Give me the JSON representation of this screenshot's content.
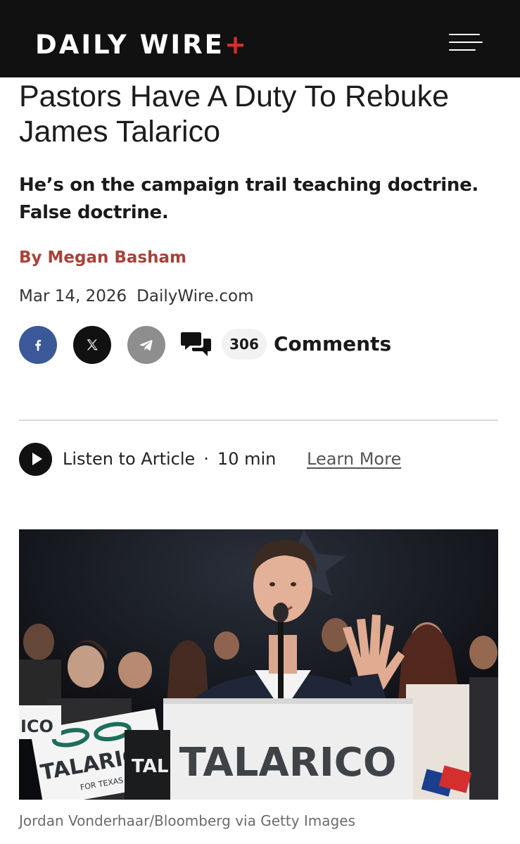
{
  "header": {
    "logo_text": "DAILY WIRE",
    "logo_plus": "+",
    "brand_color": "#d0312d",
    "menu_icon": "hamburger-menu-icon"
  },
  "article": {
    "title": "Pastors Have A Duty To Rebuke James Talarico",
    "subtitle": "He’s on the campaign trail teaching doctrine. False doctrine.",
    "byline_prefix": "By",
    "author": "Megan Basham",
    "date": "Mar 14, 2026",
    "source": "DailyWire.com",
    "author_color": "#a8423a"
  },
  "share": {
    "facebook_icon": "facebook-icon",
    "x_icon": "x-icon",
    "telegram_icon": "telegram-icon",
    "comments_icon": "comments-icon",
    "comment_count": "306",
    "comments_label": "Comments"
  },
  "audio": {
    "play_icon": "play-icon",
    "label": "Listen to Article",
    "separator": "·",
    "duration": "10 min",
    "learn_more": "Learn More"
  },
  "hero_image": {
    "podium_sign": "TALARICO",
    "sign_left": "TALARICO",
    "sign_left_sub": "FOR TEXAS",
    "sign_partial_1": "ICO",
    "sign_partial_2": "TAL",
    "caption": "Jordan Vonderhaar/Bloomberg via Getty Images"
  }
}
